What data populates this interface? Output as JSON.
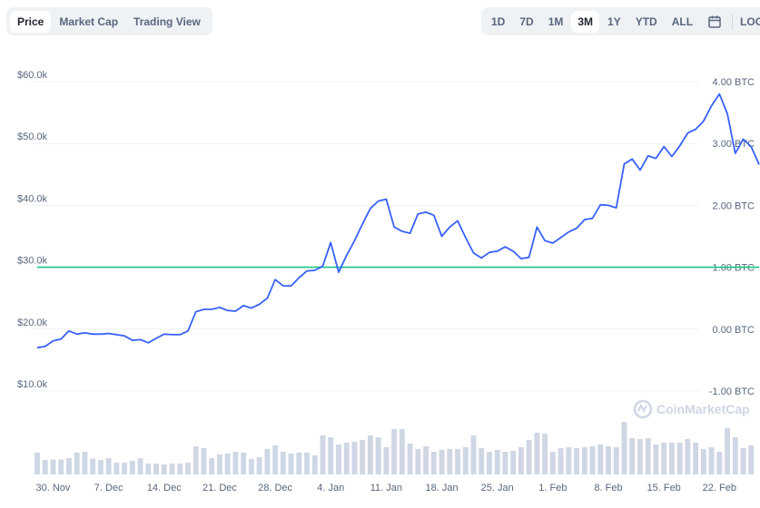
{
  "tabs": [
    {
      "label": "Price",
      "active": true
    },
    {
      "label": "Market Cap",
      "active": false
    },
    {
      "label": "Trading View",
      "active": false
    }
  ],
  "ranges": [
    {
      "label": "1D",
      "active": false
    },
    {
      "label": "7D",
      "active": false
    },
    {
      "label": "1M",
      "active": false
    },
    {
      "label": "3M",
      "active": true
    },
    {
      "label": "1Y",
      "active": false
    },
    {
      "label": "YTD",
      "active": false
    },
    {
      "label": "ALL",
      "active": false
    }
  ],
  "calendar_icon": "calendar-icon",
  "log_label": "LOG",
  "watermark": "CoinMarketCap",
  "colors": {
    "price_line": "#3861fb",
    "btc_line": "#16c784",
    "volume_bar": "#cfd6e4",
    "grid": "#eff2f5"
  },
  "chart_data": {
    "type": "line",
    "y_left_ticks": [
      "$60.0k",
      "$50.0k",
      "$40.0k",
      "$30.0k",
      "$20.0k",
      "$10.0k"
    ],
    "y_left_values": [
      60000,
      50000,
      40000,
      30000,
      20000,
      10000
    ],
    "y_right_ticks": [
      "4.00 BTC",
      "3.00 BTC",
      "2.00 BTC",
      "1.00 BTC",
      "0.00 BTC",
      "-1.00 BTC"
    ],
    "ylim_left": [
      10000,
      60000
    ],
    "ylim_right": [
      -1,
      4
    ],
    "x_ticks": [
      {
        "label": "30. Nov",
        "day": 2
      },
      {
        "label": "7. Dec",
        "day": 9
      },
      {
        "label": "14. Dec",
        "day": 16
      },
      {
        "label": "21. Dec",
        "day": 23
      },
      {
        "label": "28. Dec",
        "day": 30
      },
      {
        "label": "4. Jan",
        "day": 37
      },
      {
        "label": "11. Jan",
        "day": 44
      },
      {
        "label": "18. Jan",
        "day": 51
      },
      {
        "label": "25. Jan",
        "day": 58
      },
      {
        "label": "1. Feb",
        "day": 65
      },
      {
        "label": "8. Feb",
        "day": 72
      },
      {
        "label": "15. Feb",
        "day": 79
      },
      {
        "label": "22. Feb",
        "day": 86
      }
    ],
    "series": [
      {
        "values": [
          17000,
          17200,
          18100,
          18400,
          19700,
          19200,
          19400,
          19200,
          19200,
          19300,
          19100,
          18900,
          18200,
          18300,
          17800,
          18500,
          19200,
          19100,
          19100,
          19700,
          22800,
          23200,
          23200,
          23500,
          23000,
          22900,
          23800,
          23400,
          24000,
          25000,
          28000,
          27000,
          27000,
          28300,
          29400,
          29500,
          30200,
          34000,
          29200,
          31900,
          34300,
          37000,
          39500,
          40700,
          41000,
          36500,
          35800,
          35500,
          38600,
          38900,
          38400,
          35000,
          36500,
          37500,
          34800,
          32300,
          31500,
          32400,
          32600,
          33300,
          32600,
          31400,
          31600,
          36500,
          34300,
          33900,
          34800,
          35700,
          36300,
          37700,
          37900,
          40100,
          40000,
          39600,
          46700,
          47500,
          45700,
          48000,
          47600,
          49500,
          47900,
          49600,
          51700,
          52300,
          53600,
          56100,
          58000,
          54800,
          48400,
          50700,
          49500,
          46600
        ]
      },
      {
        "values": [
          1,
          1,
          1,
          1,
          1,
          1,
          1,
          1,
          1,
          1,
          1,
          1,
          1,
          1,
          1,
          1,
          1,
          1,
          1,
          1,
          1,
          1,
          1,
          1,
          1,
          1,
          1,
          1,
          1,
          1,
          1,
          1,
          1,
          1,
          1,
          1,
          1,
          1,
          1,
          1,
          1,
          1,
          1,
          1,
          1,
          1,
          1,
          1,
          1,
          1,
          1,
          1,
          1,
          1,
          1,
          1,
          1,
          1,
          1,
          1,
          1,
          1,
          1,
          1,
          1,
          1,
          1,
          1,
          1,
          1,
          1,
          1,
          1,
          1,
          1,
          1,
          1,
          1,
          1,
          1,
          1,
          1,
          1,
          1,
          1,
          1,
          1,
          1,
          1,
          1,
          1,
          1
        ]
      }
    ],
    "volume": [
      0.48,
      0.32,
      0.33,
      0.33,
      0.36,
      0.48,
      0.5,
      0.35,
      0.32,
      0.36,
      0.26,
      0.26,
      0.3,
      0.36,
      0.24,
      0.24,
      0.22,
      0.24,
      0.24,
      0.26,
      0.62,
      0.58,
      0.36,
      0.44,
      0.46,
      0.5,
      0.48,
      0.34,
      0.38,
      0.56,
      0.64,
      0.5,
      0.46,
      0.48,
      0.48,
      0.42,
      0.86,
      0.82,
      0.66,
      0.7,
      0.72,
      0.76,
      0.86,
      0.82,
      0.6,
      1.0,
      1.0,
      0.68,
      0.56,
      0.62,
      0.5,
      0.54,
      0.56,
      0.56,
      0.6,
      0.86,
      0.58,
      0.5,
      0.54,
      0.5,
      0.52,
      0.6,
      0.76,
      0.92,
      0.9,
      0.5,
      0.58,
      0.6,
      0.58,
      0.6,
      0.62,
      0.66,
      0.62,
      0.6,
      1.16,
      0.8,
      0.78,
      0.8,
      0.66,
      0.7,
      0.7,
      0.7,
      0.78,
      0.7,
      0.56,
      0.6,
      0.5,
      1.02,
      0.82,
      0.58,
      0.64
    ]
  }
}
